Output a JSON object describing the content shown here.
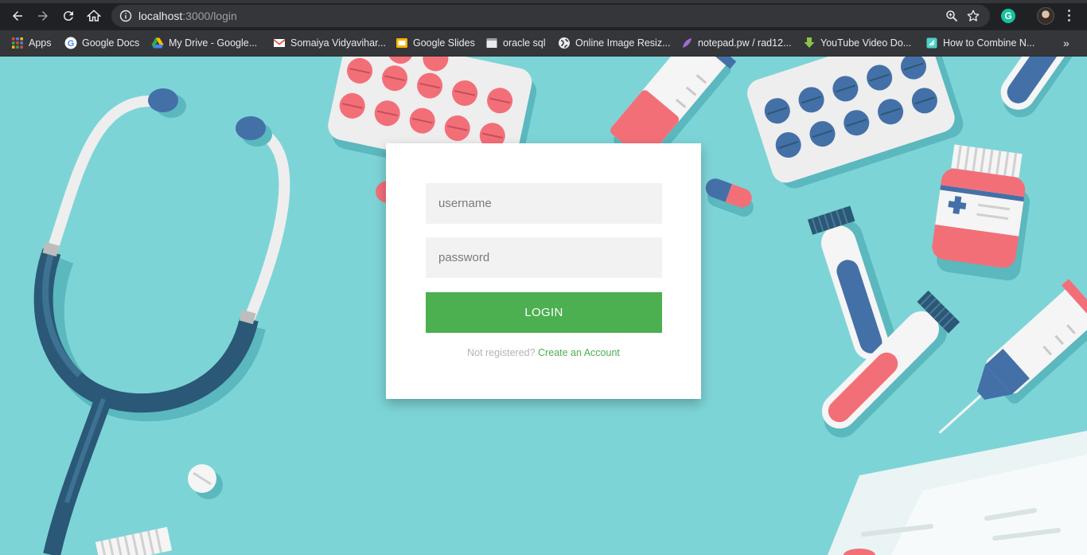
{
  "browser": {
    "url_host": "localhost",
    "url_path": ":3000/login",
    "extension_label": "G"
  },
  "bookmarks": [
    {
      "label": "Apps",
      "icon": "apps-grid-icon"
    },
    {
      "label": "Google Docs",
      "icon": "google-g-icon"
    },
    {
      "label": "My Drive - Google...",
      "icon": "google-drive-icon"
    },
    {
      "label": "Somaiya Vidyavihar...",
      "icon": "gmail-icon"
    },
    {
      "label": "Google Slides",
      "icon": "google-slides-icon"
    },
    {
      "label": "oracle sql",
      "icon": "page-icon"
    },
    {
      "label": "Online Image Resiz...",
      "icon": "globe-icon"
    },
    {
      "label": "notepad.pw / rad12...",
      "icon": "feather-icon"
    },
    {
      "label": "YouTube Video Do...",
      "icon": "download-arrow-icon"
    },
    {
      "label": "How to Combine N...",
      "icon": "diamond-icon"
    }
  ],
  "bookmarks_overflow": "»",
  "login": {
    "username_placeholder": "username",
    "password_placeholder": "password",
    "button_label": "login",
    "not_registered_text": "Not registered? ",
    "create_account_link": "Create an Account"
  },
  "colors": {
    "background": "#7dd4d6",
    "accent_green": "#4caf50",
    "pill_red": "#f36f78",
    "navy": "#2b5876",
    "blue": "#4470a8"
  }
}
